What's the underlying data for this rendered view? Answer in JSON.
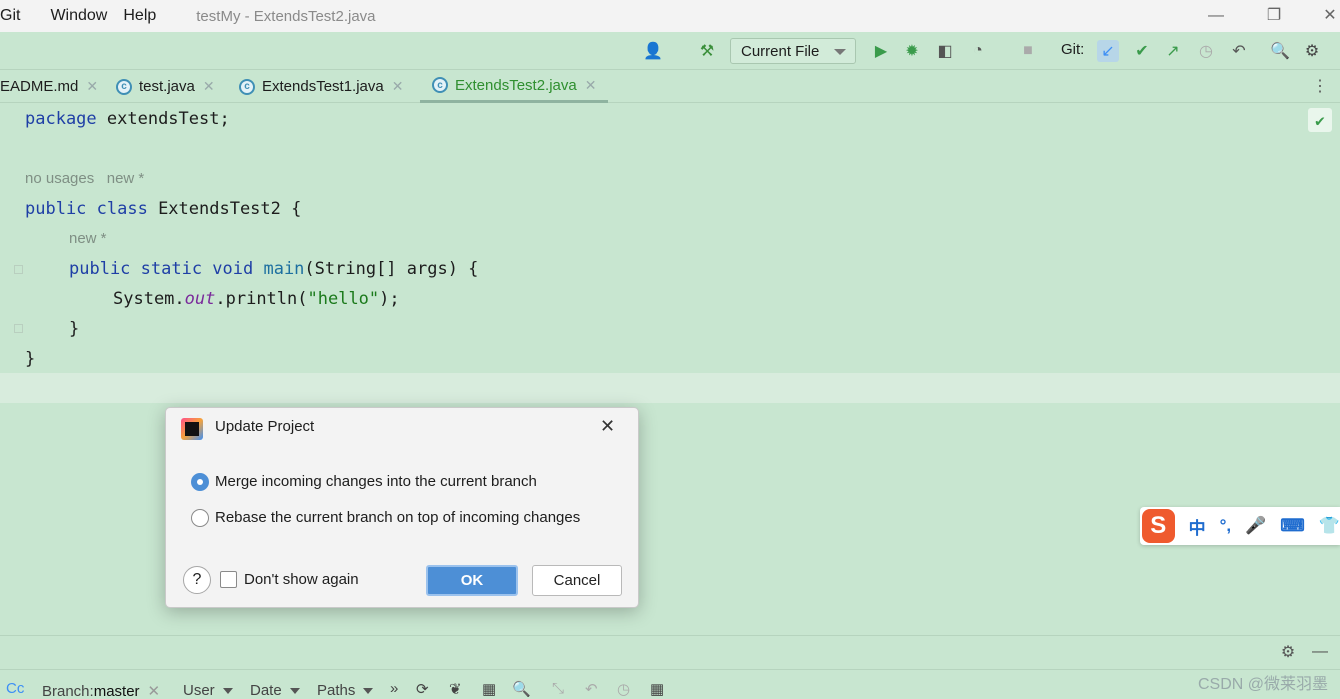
{
  "menu": {
    "items": [
      "Git",
      "Window",
      "Help"
    ],
    "window_title": "testMy - ExtendsTest2.java"
  },
  "window_controls": {
    "minimize": "—",
    "restore": "❐",
    "close": "✕"
  },
  "toolbar": {
    "run_config": "Current File",
    "git_label": "Git:"
  },
  "tabs": [
    {
      "label": "EADME.md"
    },
    {
      "label": "test.java"
    },
    {
      "label": "ExtendsTest1.java"
    },
    {
      "label": "ExtendsTest2.java"
    }
  ],
  "editor": {
    "line1_kw": "package",
    "line1_rest": " extendsTest;",
    "hint1": "no usages   new *",
    "line2_kw": "public class",
    "line2_rest": " ExtendsTest2 {",
    "hint2": "new *",
    "line3_kw": "public static void",
    "line3_fn": " main",
    "line3_rest": "(String[] args) {",
    "line4_a": "System.",
    "line4_field": "out",
    "line4_b": ".println(",
    "line4_str": "\"hello\"",
    "line4_c": ");",
    "line5": "}",
    "line6": "}"
  },
  "dialog": {
    "title": "Update Project",
    "option_merge": "Merge incoming changes into the current branch",
    "option_rebase": "Rebase the current branch on top of incoming changes",
    "selected": "merge",
    "dont_show": "Don't show again",
    "ok": "OK",
    "cancel": "Cancel",
    "help": "?"
  },
  "vcs": {
    "left_tab": "Cc",
    "branch_label": "Branch: ",
    "branch_value": "master",
    "user": "User",
    "date": "Date",
    "paths": "Paths",
    "more": "»"
  },
  "ime": {
    "logo": "S",
    "chinese": "中",
    "punct": "°,",
    "mic": "🎤",
    "keyboard": "⌨",
    "shirt": "👕"
  },
  "watermark": "CSDN @微莱羽墨"
}
